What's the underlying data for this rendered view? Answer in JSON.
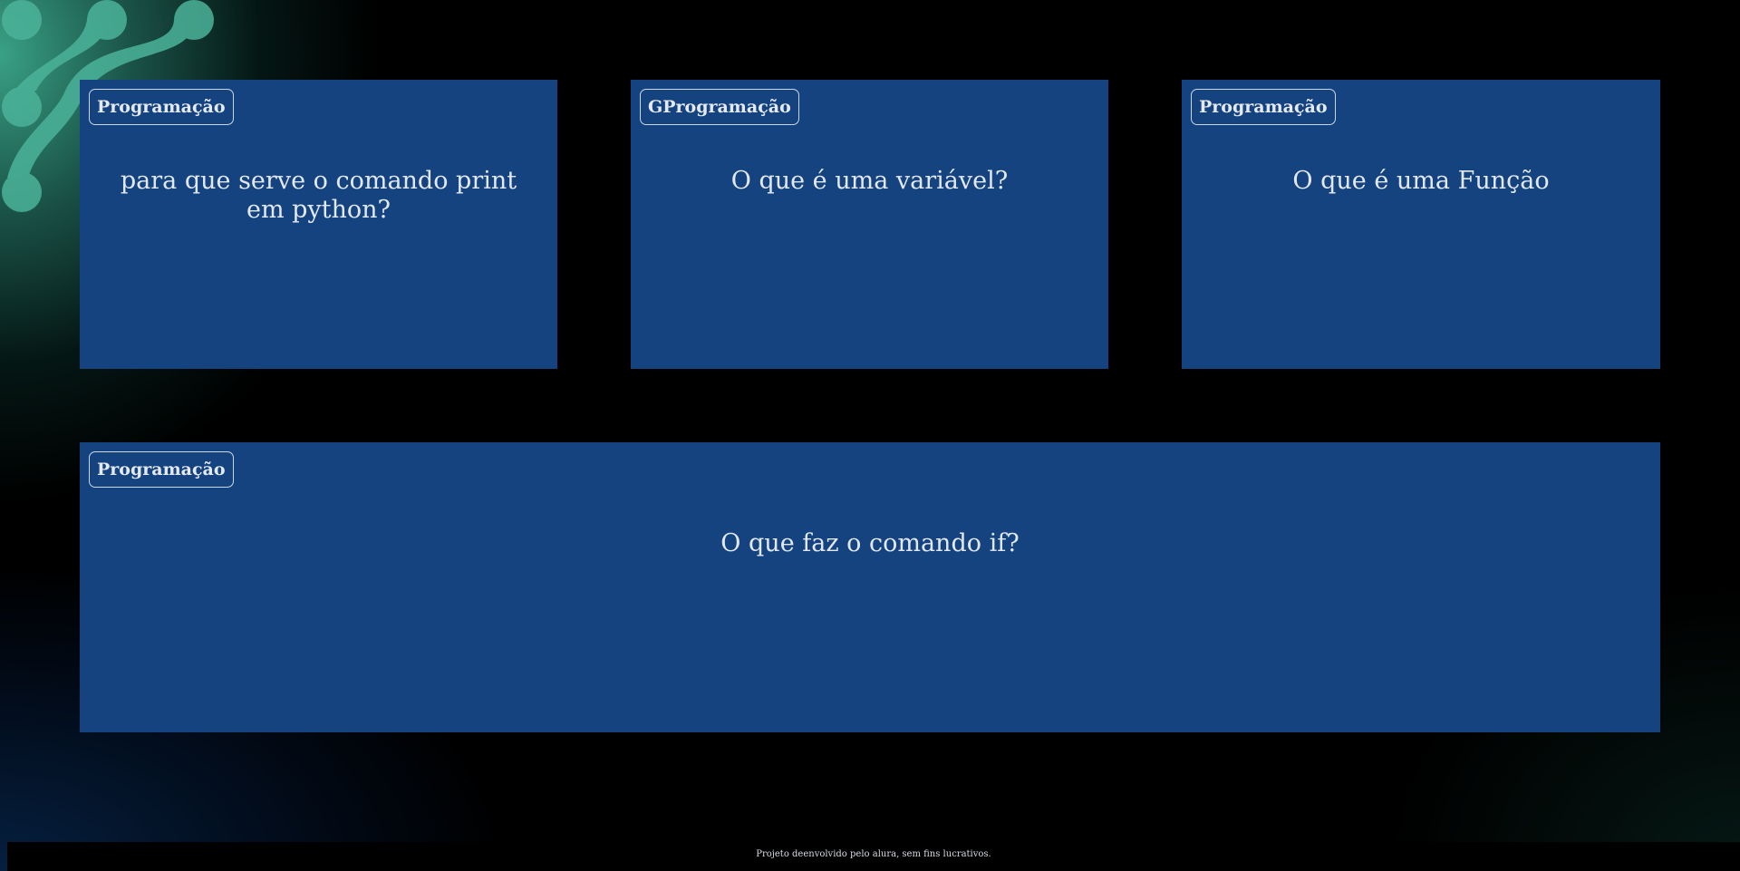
{
  "cards": [
    {
      "category": "Programação",
      "question": "para que serve o comando print em python?"
    },
    {
      "category": "GProgramação",
      "question": "O que é uma variável?"
    },
    {
      "category": "Programação",
      "question": "O que é uma Função"
    },
    {
      "category": "Programação",
      "question": "O que faz o comando if?"
    }
  ],
  "footer": {
    "text": "Projeto deenvolvido pelo alura, sem fins lucrativos."
  },
  "colors": {
    "card_background": "#144380",
    "page_background": "#000000",
    "accent_teal": "#3fae93"
  },
  "decoration": {
    "icon": "organic-dots-pattern"
  }
}
